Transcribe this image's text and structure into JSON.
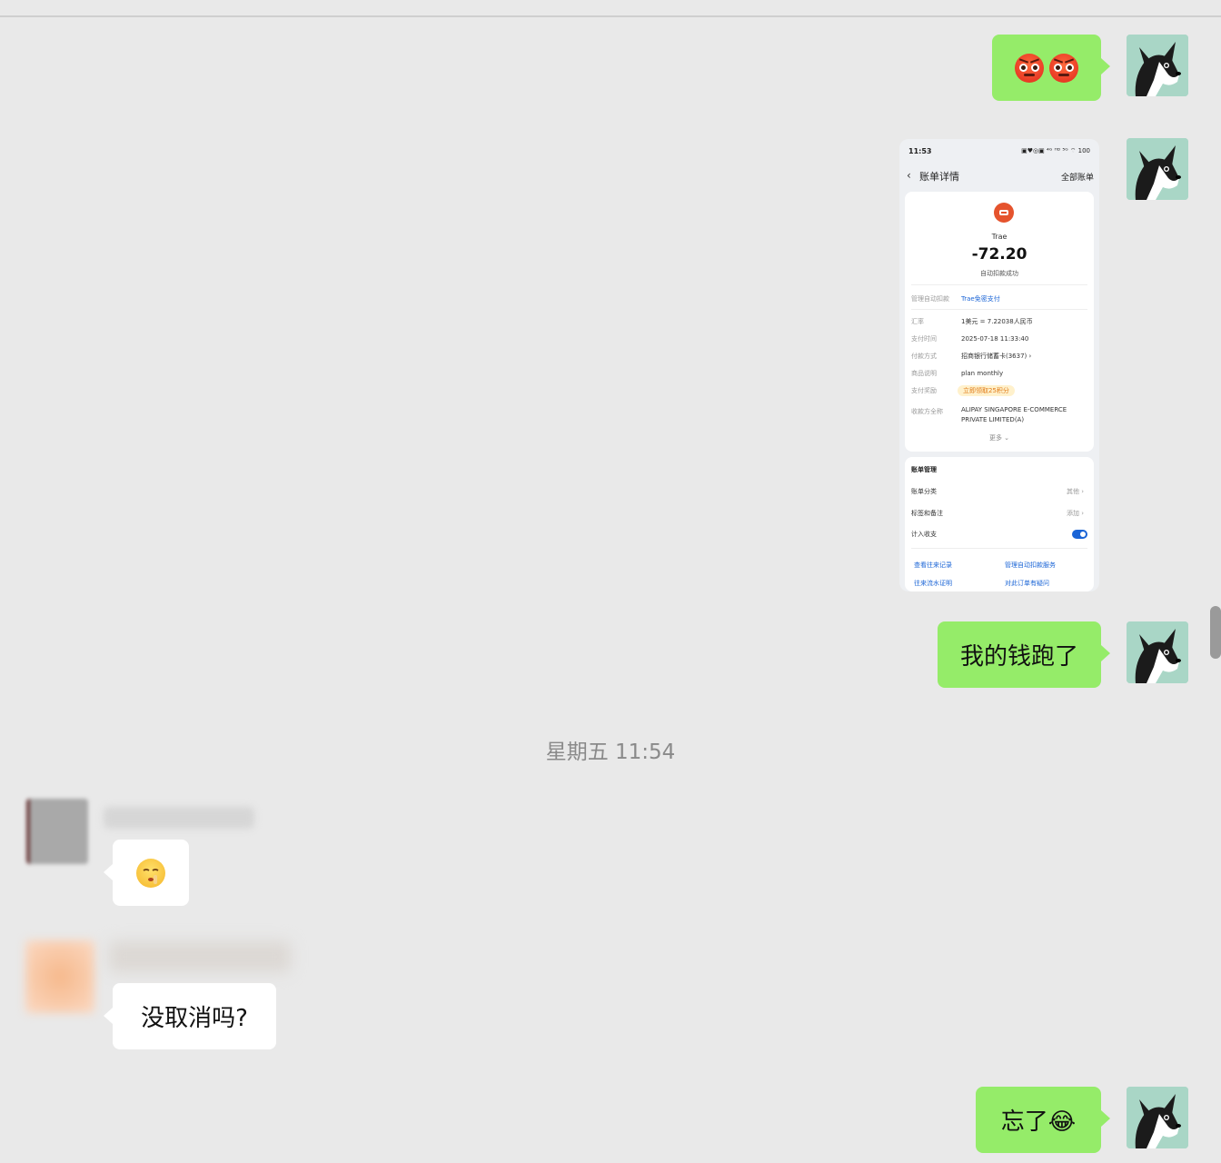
{
  "messages": {
    "m1": {
      "emoji": "😡😡"
    },
    "m3": {
      "text": "我的钱跑了"
    },
    "timestamp": "星期五 11:54",
    "m4": {
      "emoji": "🤫"
    },
    "m5": {
      "text": "没取消吗?"
    },
    "m6": {
      "text": "忘了😂"
    }
  },
  "screenshot": {
    "status_time": "11:53",
    "status_icons": "▣♥◎▣ ⁴ᴳ ᴴᴰ ⁵ᴳ ⌔ 100",
    "nav_title": "账单详情",
    "nav_all": "全部账单",
    "merchant": "Trae",
    "amount": "-72.20",
    "status": "自动扣款成功",
    "rows": [
      {
        "key": "管理自动扣款",
        "value": "Trae免密支付"
      },
      {
        "key": "汇率",
        "value": "1美元 = 7.22038人民币"
      },
      {
        "key": "支付时间",
        "value": "2025-07-18 11:33:40"
      },
      {
        "key": "付款方式",
        "value": "招商银行储蓄卡(3637) ›"
      },
      {
        "key": "商品说明",
        "value": "plan monthly"
      },
      {
        "key": "支付奖励",
        "value": "立即领取25积分"
      },
      {
        "key": "收款方全称",
        "value": "ALIPAY SINGAPORE E-COMMERCE PRIVATE LIMITED(A)"
      }
    ],
    "more": "更多 ⌄",
    "manage_title": "账单管理",
    "manage_rows": [
      {
        "key": "账单分类",
        "value": "其他 ›"
      },
      {
        "key": "标签和备注",
        "value": "添加 ›"
      },
      {
        "key": "计入收支",
        "value": ""
      }
    ],
    "links": [
      "查看往来记录",
      "管理自动扣款服务",
      "往来流水证明",
      "对此订单有疑问"
    ]
  }
}
